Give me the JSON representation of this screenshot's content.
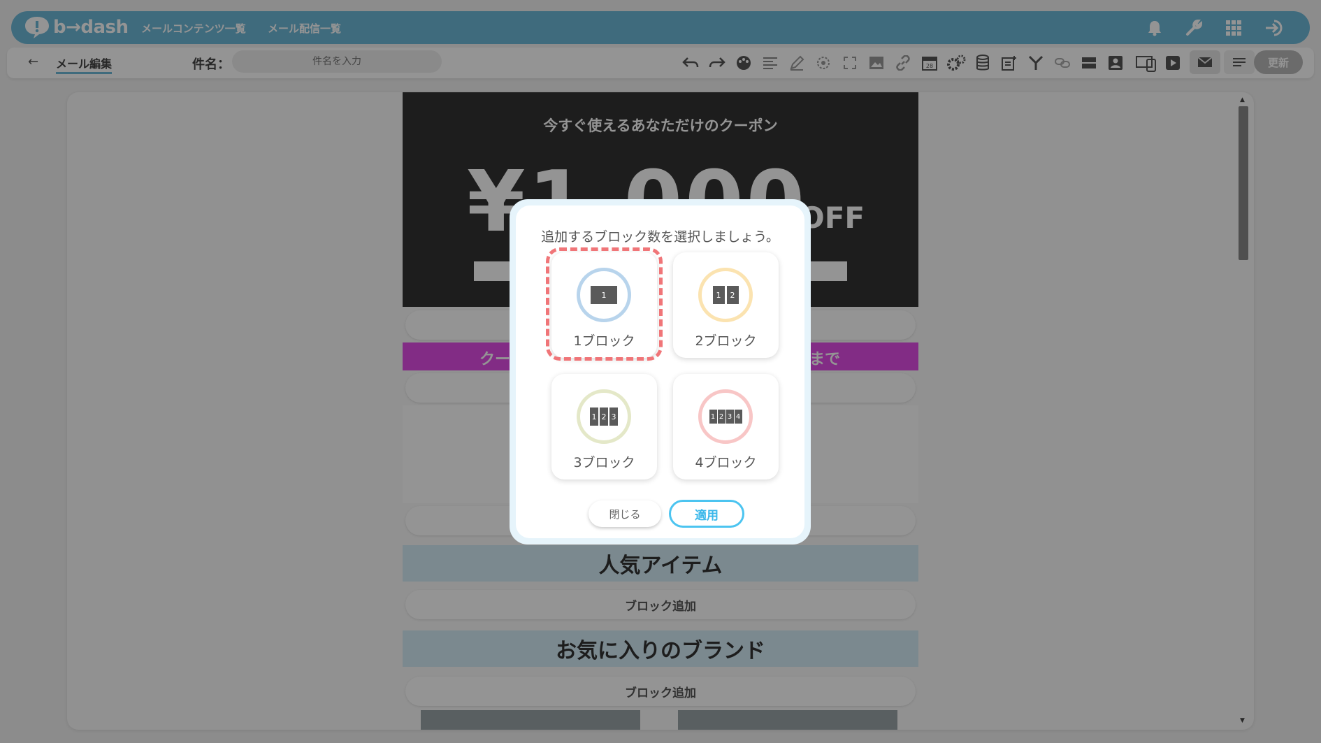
{
  "header": {
    "logo_text": "b→dash",
    "nav": [
      "メールコンテンツ一覧",
      "メール配信一覧"
    ],
    "icons": [
      "bell-icon",
      "wrench-icon",
      "apps-grid-icon",
      "logout-icon"
    ]
  },
  "toolbar": {
    "back_label": "←",
    "title": "メール編集",
    "subject_label": "件名：",
    "subject_placeholder": "件名を入力",
    "subject_value": "",
    "icons": [
      "undo-icon",
      "redo-icon",
      "palette-icon",
      "align-icon",
      "pen-icon",
      "target-icon",
      "fullscreen-icon",
      "image-icon",
      "link-icon",
      "calendar-icon",
      "gears-icon",
      "database-icon",
      "note-add-icon",
      "merge-icon",
      "chain-icon",
      "view-row-icon",
      "contact-icon",
      "device-icon",
      "video-icon",
      "mail-icon",
      "list-icon"
    ],
    "update_label": "更新"
  },
  "email": {
    "coupon_title": "今すぐ使えるあなただけのクーポン",
    "coupon_amount": "¥1,000",
    "coupon_off": "OFF",
    "banner_left": "クー",
    "banner_right": "まで",
    "section_popular": "人気アイテム",
    "section_brand": "お気に入りのブランド",
    "add_block_label": "ブロック追加"
  },
  "modal": {
    "title": "追加するブロック数を選択しましょう。",
    "options": [
      {
        "label": "1ブロック",
        "cells": [
          "1"
        ],
        "ring_color": "#b8d4ec",
        "selected": true
      },
      {
        "label": "2ブロック",
        "cells": [
          "1",
          "2"
        ],
        "ring_color": "#fbe3b0",
        "selected": false
      },
      {
        "label": "3ブロック",
        "cells": [
          "1",
          "2",
          "3"
        ],
        "ring_color": "#e4e8c8",
        "selected": false
      },
      {
        "label": "4ブロック",
        "cells": [
          "1",
          "2",
          "3",
          "4"
        ],
        "ring_color": "#f8c6c6",
        "selected": false
      }
    ],
    "close_label": "閉じる",
    "apply_label": "適用",
    "accent_color": "#4cc4f0",
    "selection_color": "#f07578"
  }
}
